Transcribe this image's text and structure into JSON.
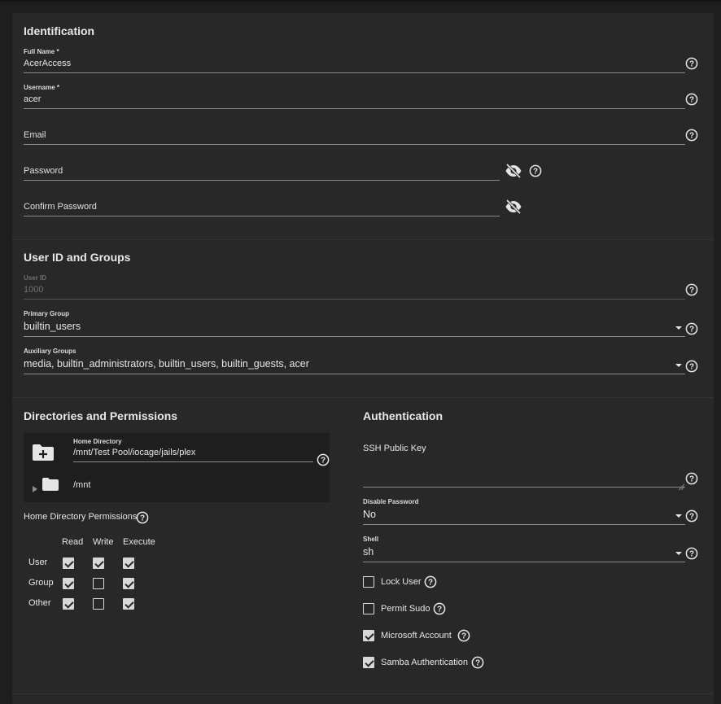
{
  "identification": {
    "title": "Identification",
    "full_name": {
      "label": "Full Name *",
      "value": "AcerAccess"
    },
    "username": {
      "label": "Username *",
      "value": "acer"
    },
    "email": {
      "label": "Email"
    },
    "password": {
      "label": "Password"
    },
    "confirm_password": {
      "label": "Confirm Password"
    }
  },
  "user_id_groups": {
    "title": "User ID and Groups",
    "user_id": {
      "label": "User ID",
      "value": "1000"
    },
    "primary_group": {
      "label": "Primary Group",
      "value": "builtin_users"
    },
    "auxiliary_groups": {
      "label": "Auxiliary Groups",
      "value": "media, builtin_administrators, builtin_users, builtin_guests, acer"
    }
  },
  "directories": {
    "title": "Directories and Permissions",
    "home_directory": {
      "label": "Home Directory",
      "value": "/mnt/Test Pool/iocage/jails/plex"
    },
    "tree_root": "/mnt",
    "permissions_label": "Home Directory Permissions",
    "columns": [
      "Read",
      "Write",
      "Execute"
    ],
    "rows": [
      {
        "label": "User",
        "read": true,
        "write": true,
        "execute": true
      },
      {
        "label": "Group",
        "read": true,
        "write": false,
        "execute": true
      },
      {
        "label": "Other",
        "read": true,
        "write": false,
        "execute": true
      }
    ]
  },
  "authentication": {
    "title": "Authentication",
    "ssh_public_key": {
      "label": "SSH Public Key"
    },
    "disable_password": {
      "label": "Disable Password",
      "value": "No"
    },
    "shell": {
      "label": "Shell",
      "value": "sh"
    },
    "lock_user": {
      "label": "Lock User",
      "checked": false
    },
    "permit_sudo": {
      "label": "Permit Sudo",
      "checked": false
    },
    "microsoft_account": {
      "label": "Microsoft Account",
      "checked": true
    },
    "samba_authentication": {
      "label": "Samba Authentication",
      "checked": true
    }
  }
}
